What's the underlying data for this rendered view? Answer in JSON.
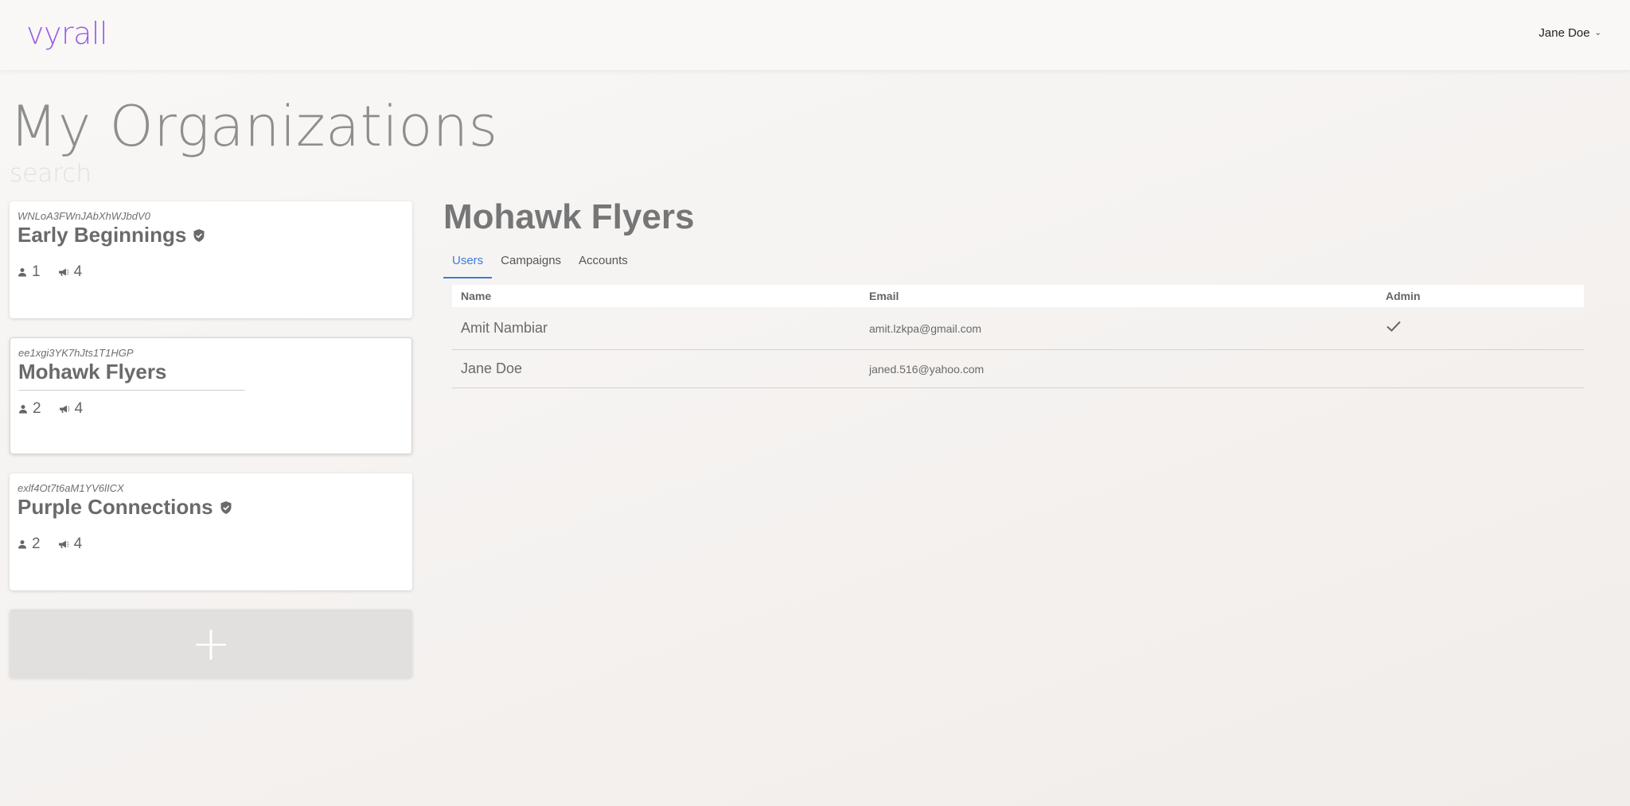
{
  "app": {
    "logo": "vyrall"
  },
  "user_menu": {
    "name": "Jane Doe"
  },
  "page": {
    "title": "My Organizations"
  },
  "search": {
    "placeholder": "search",
    "value": ""
  },
  "organizations": [
    {
      "id": "WNLoA3FWnJAbXhWJbdV0",
      "name": "Early Beginnings",
      "verified": true,
      "users": "1",
      "campaigns": "4"
    },
    {
      "id": "ee1xgi3YK7hJts1T1HGP",
      "name": "Mohawk Flyers",
      "verified": false,
      "users": "2",
      "campaigns": "4"
    },
    {
      "id": "exlf4Ot7t6aM1YV6lICX",
      "name": "Purple Connections",
      "verified": true,
      "users": "2",
      "campaigns": "4"
    }
  ],
  "add_org": {
    "label": "+"
  },
  "detail": {
    "title": "Mohawk Flyers",
    "tabs": [
      {
        "label": "Users",
        "active": true
      },
      {
        "label": "Campaigns",
        "active": false
      },
      {
        "label": "Accounts",
        "active": false
      }
    ],
    "columns": {
      "name": "Name",
      "email": "Email",
      "admin": "Admin"
    },
    "rows": [
      {
        "name": "Amit Nambiar",
        "email": "amit.lzkpa@gmail.com",
        "admin": true
      },
      {
        "name": "Jane Doe",
        "email": "janed.516@yahoo.com",
        "admin": false
      }
    ]
  },
  "colors": {
    "accent": "#3f7ad9",
    "brand": "#9b5de5"
  }
}
